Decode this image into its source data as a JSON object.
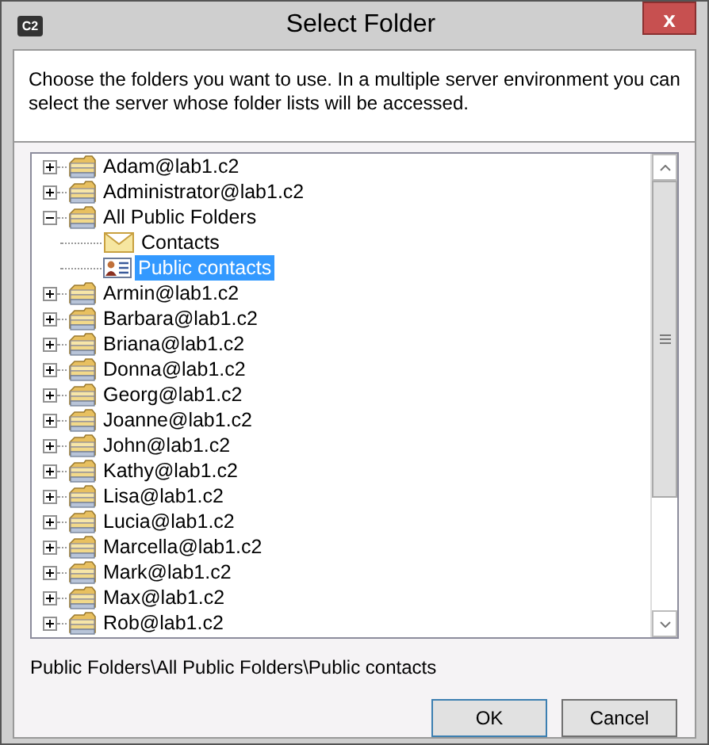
{
  "window": {
    "app_badge": "C2",
    "title": "Select Folder",
    "close": "x"
  },
  "instructions": "Choose the folders you want to use. In a multiple server environment you can select the server whose folder lists will be accessed.",
  "tree": [
    {
      "label": "Adam@lab1.c2",
      "kind": "folder",
      "expanded": false,
      "selected": false
    },
    {
      "label": "Administrator@lab1.c2",
      "kind": "folder",
      "expanded": false,
      "selected": false
    },
    {
      "label": "All Public Folders",
      "kind": "folder",
      "expanded": true,
      "selected": false,
      "children": [
        {
          "label": "Contacts",
          "kind": "mail",
          "selected": false
        },
        {
          "label": "Public contacts",
          "kind": "contacts",
          "selected": true
        }
      ]
    },
    {
      "label": "Armin@lab1.c2",
      "kind": "folder",
      "expanded": false,
      "selected": false
    },
    {
      "label": "Barbara@lab1.c2",
      "kind": "folder",
      "expanded": false,
      "selected": false
    },
    {
      "label": "Briana@lab1.c2",
      "kind": "folder",
      "expanded": false,
      "selected": false
    },
    {
      "label": "Donna@lab1.c2",
      "kind": "folder",
      "expanded": false,
      "selected": false
    },
    {
      "label": "Georg@lab1.c2",
      "kind": "folder",
      "expanded": false,
      "selected": false
    },
    {
      "label": "Joanne@lab1.c2",
      "kind": "folder",
      "expanded": false,
      "selected": false
    },
    {
      "label": "John@lab1.c2",
      "kind": "folder",
      "expanded": false,
      "selected": false
    },
    {
      "label": "Kathy@lab1.c2",
      "kind": "folder",
      "expanded": false,
      "selected": false
    },
    {
      "label": "Lisa@lab1.c2",
      "kind": "folder",
      "expanded": false,
      "selected": false
    },
    {
      "label": "Lucia@lab1.c2",
      "kind": "folder",
      "expanded": false,
      "selected": false
    },
    {
      "label": "Marcella@lab1.c2",
      "kind": "folder",
      "expanded": false,
      "selected": false
    },
    {
      "label": "Mark@lab1.c2",
      "kind": "folder",
      "expanded": false,
      "selected": false
    },
    {
      "label": "Max@lab1.c2",
      "kind": "folder",
      "expanded": false,
      "selected": false
    },
    {
      "label": "Rob@lab1.c2",
      "kind": "folder",
      "expanded": false,
      "selected": false
    }
  ],
  "path": "Public Folders\\All Public Folders\\Public contacts",
  "buttons": [
    {
      "label": "OK",
      "kind": "default"
    },
    {
      "label": "Cancel",
      "kind": "normal"
    }
  ]
}
